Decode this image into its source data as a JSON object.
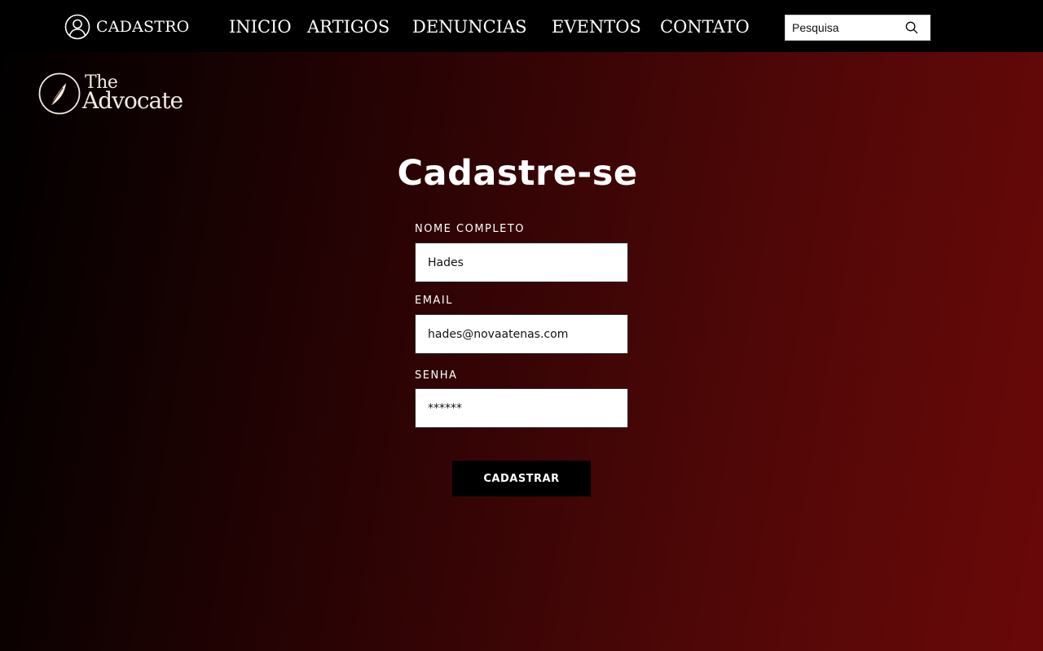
{
  "header": {
    "account_label": "CADASTRO",
    "nav": {
      "inicio": "INICIO",
      "artigos": "ARTIGOS",
      "denuncias": "DENUNCIAS",
      "eventos": "EVENTOS",
      "contato": "CONTATO"
    },
    "search": {
      "placeholder": "Pesquisa",
      "value": ""
    }
  },
  "brand": {
    "line1": "The",
    "line2": "Advocate"
  },
  "form": {
    "title": "Cadastre-se",
    "name_label": "NOME COMPLETO",
    "name_value": "Hades",
    "email_label": "EMAIL",
    "email_value": "hades@novaatenas.com",
    "password_label": "SENHA",
    "password_value": "******",
    "submit_label": "CADASTRAR"
  },
  "colors": {
    "topbar": "#000000",
    "gradient_dark": "#000000",
    "gradient_red": "#6a0808",
    "logo_text": "#f3eadf",
    "button": "#000000"
  },
  "icons": {
    "account": "user-circle-icon",
    "search": "search-icon",
    "logo": "quill-feather-icon"
  }
}
